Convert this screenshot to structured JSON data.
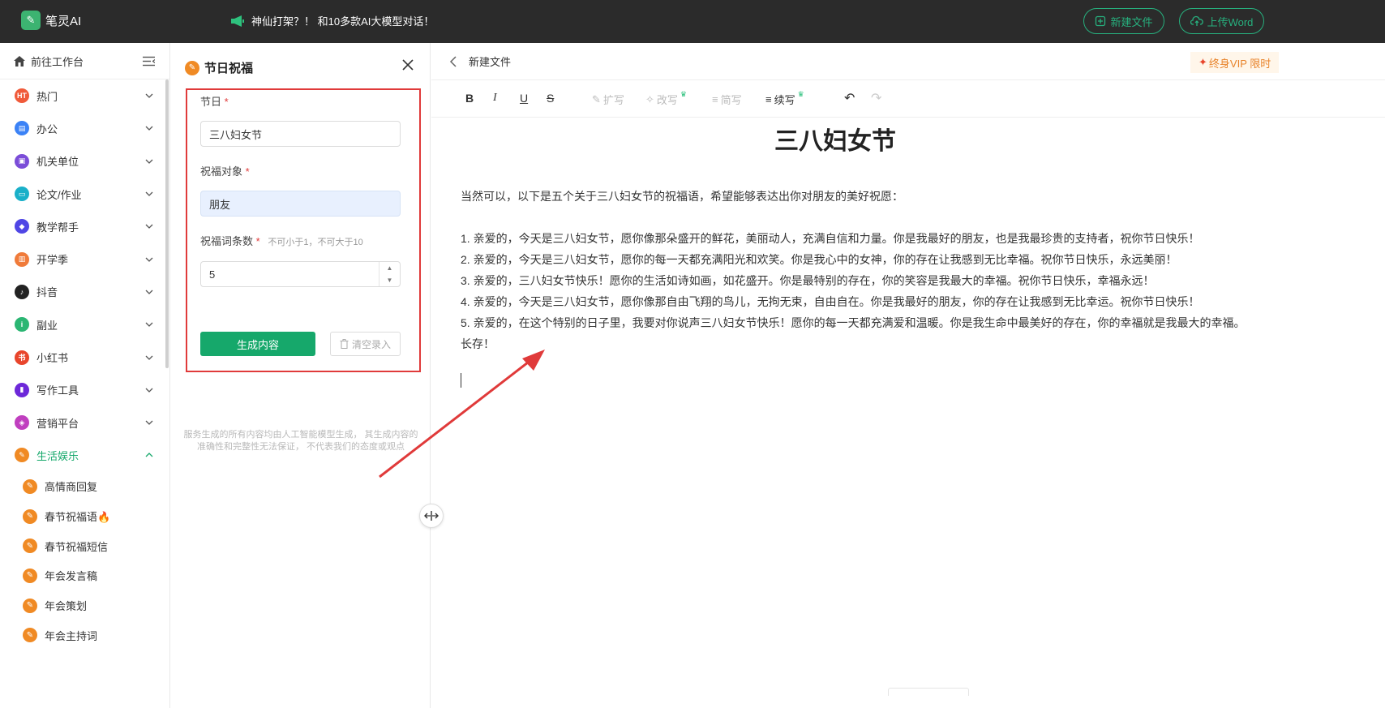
{
  "topbar": {
    "logo_text": "笔灵AI",
    "promo_text": "神仙打架？！ 和10多款AI大模型对话！",
    "new_file_label": "新建文件",
    "upload_label": "上传Word"
  },
  "sidebar": {
    "workspace_label": "前往工作台",
    "items": [
      {
        "label": "热门",
        "icon": "fire-icon",
        "color": "#f05a3a",
        "glyph": "HT"
      },
      {
        "label": "办公",
        "icon": "briefcase-icon",
        "color": "#3b82f6",
        "glyph": "▤"
      },
      {
        "label": "机关单位",
        "icon": "building-icon",
        "color": "#7b4dd8",
        "glyph": "▣"
      },
      {
        "label": "论文/作业",
        "icon": "paper-icon",
        "color": "#1ab0c9",
        "glyph": "▭"
      },
      {
        "label": "教学帮手",
        "icon": "graduation-icon",
        "color": "#4f46e5",
        "glyph": "◆"
      },
      {
        "label": "开学季",
        "icon": "notebook-icon",
        "color": "#f07b3a",
        "glyph": "▥"
      },
      {
        "label": "抖音",
        "icon": "tiktok-icon",
        "color": "#222222",
        "glyph": "♪"
      },
      {
        "label": "副业",
        "icon": "info-icon",
        "color": "#2bb673",
        "glyph": "i"
      },
      {
        "label": "小红书",
        "icon": "xiaohongshu-icon",
        "color": "#e8452c",
        "glyph": "书"
      },
      {
        "label": "写作工具",
        "icon": "book-icon",
        "color": "#6d28d9",
        "glyph": "▮"
      },
      {
        "label": "营销平台",
        "icon": "tag-icon",
        "color": "#c03fbf",
        "glyph": "◈"
      },
      {
        "label": "生活娱乐",
        "icon": "pencil-icon",
        "color": "#f08a24",
        "glyph": "✎"
      }
    ],
    "sub_items": [
      "高情商回复",
      "春节祝福语🔥",
      "春节祝福短信",
      "年会发言稿",
      "年会策划",
      "年会主持词"
    ]
  },
  "panel": {
    "title": "节日祝福",
    "festival_label": "节日",
    "festival_value": "三八妇女节",
    "target_label": "祝福对象",
    "target_value": "朋友",
    "count_label": "祝福词条数",
    "count_hint": "不可小于1，不可大于10",
    "count_value": "5",
    "generate_label": "生成内容",
    "clear_label": "清空录入",
    "disclaimer": "服务生成的所有内容均由人工智能模型生成， 其生成内容的准确性和完整性无法保证， 不代表我们的态度或观点"
  },
  "editor": {
    "back_label": "新建文件",
    "vip_label": "终身VIP 限时",
    "toolbar": {
      "bold": "B",
      "italic": "I",
      "underline": "U",
      "strike": "S",
      "expand": "扩写",
      "rewrite": "改写",
      "simplify": "简写",
      "continue": "续写",
      "undo": "↶",
      "redo": "↷"
    },
    "doc_title": "三八妇女节",
    "intro": "当然可以，以下是五个关于三八妇女节的祝福语，希望能够表达出你对朋友的美好祝愿：",
    "lines": [
      "1. 亲爱的，今天是三八妇女节，愿你像那朵盛开的鲜花，美丽动人，充满自信和力量。你是我最好的朋友，也是我最珍贵的支持者，祝你节日快乐！",
      "2. 亲爱的，今天是三八妇女节，愿你的每一天都充满阳光和欢笑。你是我心中的女神，你的存在让我感到无比幸福。祝你节日快乐，永远美丽！",
      "3. 亲爱的，三八妇女节快乐！愿你的生活如诗如画，如花盛开。你是最特别的存在，你的笑容是我最大的幸福。祝你节日快乐，幸福永远！",
      "4. 亲爱的，今天是三八妇女节，愿你像那自由飞翔的鸟儿，无拘无束，自由自在。你是我最好的朋友，你的存在让我感到无比幸运。祝你节日快乐！",
      "5. 亲爱的，在这个特别的日子里，我要对你说声三八妇女节快乐！愿你的每一天都充满爱和温暖。你是我生命中最美好的存在，你的幸福就是我最大的幸福。"
    ],
    "line5_cont": "长存！"
  },
  "colors": {
    "brand_green": "#16a86b",
    "highlight_red": "#e03a3a"
  }
}
